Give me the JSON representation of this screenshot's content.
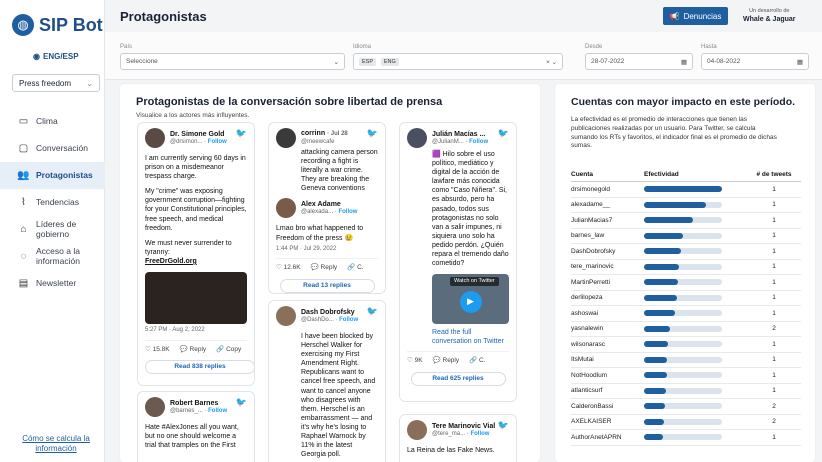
{
  "sidebar": {
    "logo": "SIP Bot",
    "lang": "ENG/ESP",
    "topic": "Press freedom",
    "items": [
      {
        "label": "Clima",
        "icon": "map-icon"
      },
      {
        "label": "Conversación",
        "icon": "chat-icon"
      },
      {
        "label": "Protagonistas",
        "icon": "users-icon"
      },
      {
        "label": "Tendencias",
        "icon": "trend-icon"
      },
      {
        "label": "Líderes de gobierno",
        "icon": "building-icon"
      },
      {
        "label": "Acceso a la información",
        "icon": "globe-icon"
      },
      {
        "label": "Newsletter",
        "icon": "newsletter-icon"
      }
    ],
    "help": "Cómo se calcula la información"
  },
  "header": {
    "title": "Protagonistas",
    "denuncias": "Denuncias",
    "dev_small": "Un desarrollo de",
    "dev_big": "Whale & Jaguar"
  },
  "filters": {
    "pais_label": "País",
    "pais_placeholder": "Seleccione",
    "idioma_label": "Idioma",
    "idioma_chips": [
      "ESP",
      "ENG"
    ],
    "desde_label": "Desde",
    "desde_value": "28-07-2022",
    "hasta_label": "Hasta",
    "hasta_value": "04-08-2022"
  },
  "left": {
    "title": "Protagonistas de la conversación sobre libertad de prensa",
    "subtitle": "Visualice a los actores más influyentes."
  },
  "tweets": {
    "t1": {
      "name": "Dr. Simone Gold",
      "user": "@drsimon...",
      "follow": "Follow",
      "p1": "I am currently serving 60 days in prison on a misdemeanor trespass charge.",
      "p2": "My \"crime\" was exposing government corruption—fighting for your Constitutional principles, free speech, and medical freedom.",
      "p3": "We must never surrender to tyranny:",
      "link": "FreeDrGold.org",
      "meta": "5:27 PM · Aug 2, 2022",
      "likes": "15.8K",
      "reply": "Reply",
      "copy": "Copy",
      "read": "Read 838 replies"
    },
    "t2": {
      "name": "corrinn",
      "user": "@meewcafe",
      "date": "· Jul 28",
      "text": "attacking camera person recording a fight is literally a war crime. They are breaking the Geneva conventions",
      "reply_name": "Alex Adame",
      "reply_user": "@alexada...",
      "follow": "Follow",
      "reply_text": "Lmao bro what happened to Freedom of the press 😢",
      "meta": "1:44 PM · Jul 29, 2022",
      "likes": "12.6K",
      "reply": "Reply",
      "copy": "C.",
      "read": "Read 13 replies"
    },
    "t3": {
      "name": "Dash Dobrofsky",
      "user": "@DashDo...",
      "follow": "Follow",
      "text": "I have been blocked by Herschel Walker for exercising my First Amendment Right. Republicans want to cancel free speech, and want to cancel anyone who disagrees with them. Herschel is an embarrassment — and it's why he's losing to Raphael Warnock by 11% in the latest Georgia poll."
    },
    "t4": {
      "name": "Julián Macías ...",
      "user": "@JulianM...",
      "follow": "Follow",
      "text": "🟪 Hilo sobre el uso político, mediático y digital de la acción de lawfare más conocida como \"Caso Niñera\". Si, es absurdo, pero ha pasado, todos sus protagonistas no solo van a salir impunes, ni siquiera uno solo ha pedido perdón. ¿Quién repara el tremendo daño cometido?",
      "watch": "Watch on Twitter",
      "conv": "Read the full conversation on Twitter",
      "likes": "9K",
      "reply": "Reply",
      "copy": "C.",
      "read": "Read 625 replies"
    },
    "t5": {
      "name": "Robert Barnes",
      "user": "@barnes_...",
      "follow": "Follow",
      "text": "Hate #AlexJones all you want, but no one should welcome a trial that tramples on the First"
    },
    "t6": {
      "name": "Tere Marinovic Vial",
      "user": "@tere_ma...",
      "follow": "Follow",
      "text": "La Reina de las Fake News."
    }
  },
  "right": {
    "title": "Cuentas con mayor impacto en este período.",
    "desc": "La efectividad es el promedio de interacciones que tienen las publicaciones realizadas por un usuario. Para Twitter, se calcula sumando los RTs y favoritos, el indicador final es el promedio de dichas sumas.",
    "col_cuenta": "Cuenta",
    "col_efect": "Efectividad",
    "col_tweets": "# de tweets",
    "rows": [
      {
        "name": "drsimonegold",
        "eff": 1.0,
        "tweets": "1"
      },
      {
        "name": "alexadame__",
        "eff": 0.8,
        "tweets": "1"
      },
      {
        "name": "JulianMacias7",
        "eff": 0.63,
        "tweets": "1"
      },
      {
        "name": "barnes_law",
        "eff": 0.5,
        "tweets": "1"
      },
      {
        "name": "DashDobrofsky",
        "eff": 0.47,
        "tweets": "1"
      },
      {
        "name": "tere_marinovic",
        "eff": 0.45,
        "tweets": "1"
      },
      {
        "name": "MartinPerretti",
        "eff": 0.43,
        "tweets": "1"
      },
      {
        "name": "derlilopeza",
        "eff": 0.42,
        "tweets": "1"
      },
      {
        "name": "ashoswai",
        "eff": 0.4,
        "tweets": "1"
      },
      {
        "name": "yasnalewin",
        "eff": 0.33,
        "tweets": "2"
      },
      {
        "name": "wilsonarasc",
        "eff": 0.31,
        "tweets": "1"
      },
      {
        "name": "ItsMutai",
        "eff": 0.3,
        "tweets": "1"
      },
      {
        "name": "NotHoodlum",
        "eff": 0.29,
        "tweets": "1"
      },
      {
        "name": "atlanticsurf",
        "eff": 0.28,
        "tweets": "1"
      },
      {
        "name": "CalderonBassi",
        "eff": 0.27,
        "tweets": "2"
      },
      {
        "name": "AXELKAISER",
        "eff": 0.26,
        "tweets": "2"
      },
      {
        "name": "AuthorAnetAPRN",
        "eff": 0.24,
        "tweets": "1"
      }
    ]
  }
}
